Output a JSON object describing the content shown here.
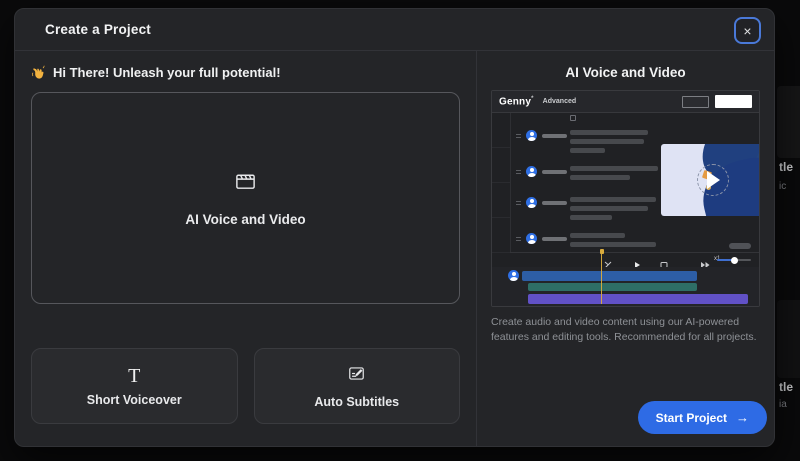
{
  "modal": {
    "title": "Create a Project",
    "close_glyph": "×"
  },
  "left_panel": {
    "greeting_emoji": "👋",
    "greeting_text": "Hi There! Unleash your full potential!",
    "primary_card_label": "AI Voice and Video",
    "cards": [
      {
        "glyph": "T",
        "label": "Short Voiceover"
      },
      {
        "label": "Auto Subtitles"
      }
    ]
  },
  "right_panel": {
    "title": "AI Voice and Video",
    "preview": {
      "app_name": "Genny",
      "app_mark": "*",
      "mode": "Advanced",
      "speed_label": "x1"
    },
    "description": "Create audio and video content using our AI-powered features and editing tools. Recommended for all projects.",
    "start_label": "Start Project",
    "start_arrow": "→"
  },
  "background_fragments": [
    "tle",
    "ic",
    "tle",
    "ia"
  ],
  "colors": {
    "page_bg": "#0a0a0b",
    "modal_bg": "#242528",
    "panel_divider": "#323338",
    "secondary_card_bg": "#2a2b2e",
    "primary_card_border": "#56575c",
    "focus_ring_blue": "#4a79d8",
    "accent_blue": "#2e6be5",
    "avatar_blue": "#2f6fe4",
    "track_blue": "#2d5ea6",
    "track_teal": "#2e6e66",
    "track_purple": "#6151c6",
    "playhead_yellow": "#d9ab3c",
    "video_panel_bg": "#dfe3f4",
    "video_navy": "#1e3c80",
    "muted_text": "#8e9196"
  }
}
